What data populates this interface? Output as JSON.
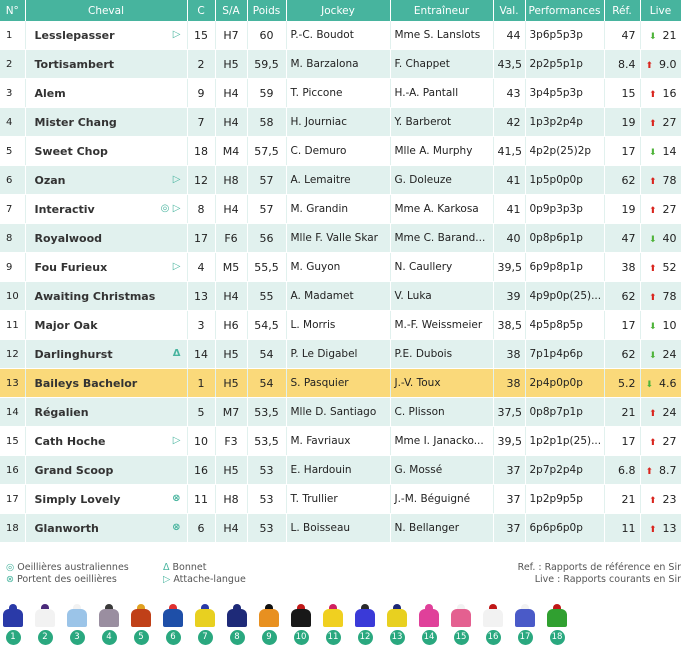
{
  "columns": [
    "N°",
    "Cheval",
    "C",
    "S/A",
    "Poids",
    "Jockey",
    "Entraîneur",
    "Val.",
    "Performances",
    "Réf.",
    "Live"
  ],
  "rows": [
    {
      "num": "1",
      "cheval": "Lesslepasser",
      "icons": "▷",
      "c": "15",
      "sa": "H7",
      "poids": "60",
      "jockey": "P.-C. Boudot",
      "entraineur": "Mme S. Lanslots",
      "val": "44",
      "perf": "3p6p5p3p",
      "ref": "47",
      "trend": "down",
      "live": "21"
    },
    {
      "num": "2",
      "cheval": "Tortisambert",
      "icons": "",
      "c": "2",
      "sa": "H5",
      "poids": "59,5",
      "jockey": "M. Barzalona",
      "entraineur": "F. Chappet",
      "val": "43,5",
      "perf": "2p2p5p1p",
      "ref": "8.4",
      "trend": "up",
      "live": "9.0"
    },
    {
      "num": "3",
      "cheval": "Alem",
      "icons": "",
      "c": "9",
      "sa": "H4",
      "poids": "59",
      "jockey": "T. Piccone",
      "entraineur": "H.-A. Pantall",
      "val": "43",
      "perf": "3p4p5p3p",
      "ref": "15",
      "trend": "up",
      "live": "16"
    },
    {
      "num": "4",
      "cheval": "Mister Chang",
      "icons": "",
      "c": "7",
      "sa": "H4",
      "poids": "58",
      "jockey": "H. Journiac",
      "entraineur": "Y. Barberot",
      "val": "42",
      "perf": "1p3p2p4p",
      "ref": "19",
      "trend": "up",
      "live": "27"
    },
    {
      "num": "5",
      "cheval": "Sweet Chop",
      "icons": "",
      "c": "18",
      "sa": "M4",
      "poids": "57,5",
      "jockey": "C. Demuro",
      "entraineur": "Mlle A. Murphy",
      "val": "41,5",
      "perf": "4p2p(25)2p",
      "ref": "17",
      "trend": "down",
      "live": "14"
    },
    {
      "num": "6",
      "cheval": "Ozan",
      "icons": "▷",
      "c": "12",
      "sa": "H8",
      "poids": "57",
      "jockey": "A. Lemaitre",
      "entraineur": "G. Doleuze",
      "val": "41",
      "perf": "1p5p0p0p",
      "ref": "62",
      "trend": "up",
      "live": "78"
    },
    {
      "num": "7",
      "cheval": "Interactiv",
      "icons": "◎ ▷",
      "c": "8",
      "sa": "H4",
      "poids": "57",
      "jockey": "M. Grandin",
      "entraineur": "Mme A. Karkosa",
      "val": "41",
      "perf": "0p9p3p3p",
      "ref": "19",
      "trend": "up",
      "live": "27"
    },
    {
      "num": "8",
      "cheval": "Royalwood",
      "icons": "",
      "c": "17",
      "sa": "F6",
      "poids": "56",
      "jockey": "Mlle F. Valle Skar",
      "entraineur": "Mme C. Barand...",
      "val": "40",
      "perf": "0p8p6p1p",
      "ref": "47",
      "trend": "down",
      "live": "40"
    },
    {
      "num": "9",
      "cheval": "Fou Furieux",
      "icons": "▷",
      "c": "4",
      "sa": "M5",
      "poids": "55,5",
      "jockey": "M. Guyon",
      "entraineur": "N. Caullery",
      "val": "39,5",
      "perf": "6p9p8p1p",
      "ref": "38",
      "trend": "up",
      "live": "52"
    },
    {
      "num": "10",
      "cheval": "Awaiting Christmas",
      "icons": "",
      "c": "13",
      "sa": "H4",
      "poids": "55",
      "jockey": "A. Madamet",
      "entraineur": "V. Luka",
      "val": "39",
      "perf": "4p9p0p(25)...",
      "ref": "62",
      "trend": "up",
      "live": "78"
    },
    {
      "num": "11",
      "cheval": "Major Oak",
      "icons": "",
      "c": "3",
      "sa": "H6",
      "poids": "54,5",
      "jockey": "L. Morris",
      "entraineur": "M.-F. Weissmeier",
      "val": "38,5",
      "perf": "4p5p8p5p",
      "ref": "17",
      "trend": "down",
      "live": "10"
    },
    {
      "num": "12",
      "cheval": "Darlinghurst",
      "icons": "Δ",
      "c": "14",
      "sa": "H5",
      "poids": "54",
      "jockey": "P. Le Digabel",
      "entraineur": "P.E. Dubois",
      "val": "38",
      "perf": "7p1p4p6p",
      "ref": "62",
      "trend": "down",
      "live": "24"
    },
    {
      "num": "13",
      "cheval": "Baileys Bachelor",
      "icons": "",
      "c": "1",
      "sa": "H5",
      "poids": "54",
      "jockey": "S. Pasquier",
      "entraineur": "J.-V. Toux",
      "val": "38",
      "perf": "2p4p0p0p",
      "ref": "5.2",
      "trend": "down",
      "live": "4.6",
      "highlight": true
    },
    {
      "num": "14",
      "cheval": "Régalien",
      "icons": "",
      "c": "5",
      "sa": "M7",
      "poids": "53,5",
      "jockey": "Mlle D. Santiago",
      "entraineur": "C. Plisson",
      "val": "37,5",
      "perf": "0p8p7p1p",
      "ref": "21",
      "trend": "up",
      "live": "24"
    },
    {
      "num": "15",
      "cheval": "Cath Hoche",
      "icons": "▷",
      "c": "10",
      "sa": "F3",
      "poids": "53,5",
      "jockey": "M. Favriaux",
      "entraineur": "Mme I. Janacko...",
      "val": "39,5",
      "perf": "1p2p1p(25)...",
      "ref": "17",
      "trend": "up",
      "live": "27"
    },
    {
      "num": "16",
      "cheval": "Grand Scoop",
      "icons": "",
      "c": "16",
      "sa": "H5",
      "poids": "53",
      "jockey": "E. Hardouin",
      "entraineur": "G. Mossé",
      "val": "37",
      "perf": "2p7p2p4p",
      "ref": "6.8",
      "trend": "up",
      "live": "8.7"
    },
    {
      "num": "17",
      "cheval": "Simply Lovely",
      "icons": "⊗",
      "c": "11",
      "sa": "H8",
      "poids": "53",
      "jockey": "T. Trullier",
      "entraineur": "J.-M. Béguigné",
      "val": "37",
      "perf": "1p2p9p5p",
      "ref": "21",
      "trend": "up",
      "live": "23"
    },
    {
      "num": "18",
      "cheval": "Glanworth",
      "icons": "⊗",
      "c": "6",
      "sa": "H4",
      "poids": "53",
      "jockey": "L. Boisseau",
      "entraineur": "N. Bellanger",
      "val": "37",
      "perf": "6p6p6p0p",
      "ref": "11",
      "trend": "up",
      "live": "13"
    }
  ],
  "legend": {
    "australiennes": "Oeillières australiennes",
    "oeilleres": "Portent des oeillières",
    "bonnet": "Bonnet",
    "langue": "Attache-langue",
    "ref": "Ref. : Rapports de référence en Sir",
    "live": "Live : Rapports courants en Sir"
  },
  "silks": [
    {
      "n": "1",
      "body": "#2a3aa8",
      "cap": "#2a3aa8"
    },
    {
      "n": "2",
      "body": "#f2f2f2",
      "cap": "#4a2a7a"
    },
    {
      "n": "3",
      "body": "#9bc4e8",
      "cap": "#f2f2f2"
    },
    {
      "n": "4",
      "body": "#9a8ea0",
      "cap": "#3a3a3a"
    },
    {
      "n": "5",
      "body": "#c04018",
      "cap": "#e0a020"
    },
    {
      "n": "6",
      "body": "#1e4fa8",
      "cap": "#e03030"
    },
    {
      "n": "7",
      "body": "#e8d020",
      "cap": "#2a3aa8"
    },
    {
      "n": "8",
      "body": "#1e2a78",
      "cap": "#1e2a78"
    },
    {
      "n": "9",
      "body": "#e89020",
      "cap": "#101010"
    },
    {
      "n": "10",
      "body": "#181818",
      "cap": "#c01818"
    },
    {
      "n": "11",
      "body": "#f0d020",
      "cap": "#d02060"
    },
    {
      "n": "12",
      "body": "#3a3ad8",
      "cap": "#2a2a2a"
    },
    {
      "n": "13",
      "body": "#e8d020",
      "cap": "#1e2a78"
    },
    {
      "n": "14",
      "body": "#e0409a",
      "cap": "#e0409a"
    },
    {
      "n": "15",
      "body": "#e46090",
      "cap": "#f2f2f2"
    },
    {
      "n": "16",
      "body": "#f2f2f2",
      "cap": "#c01818"
    },
    {
      "n": "17",
      "body": "#4a5ac8",
      "cap": "#f2f2f2"
    },
    {
      "n": "18",
      "body": "#30a030",
      "cap": "#c01818"
    }
  ]
}
